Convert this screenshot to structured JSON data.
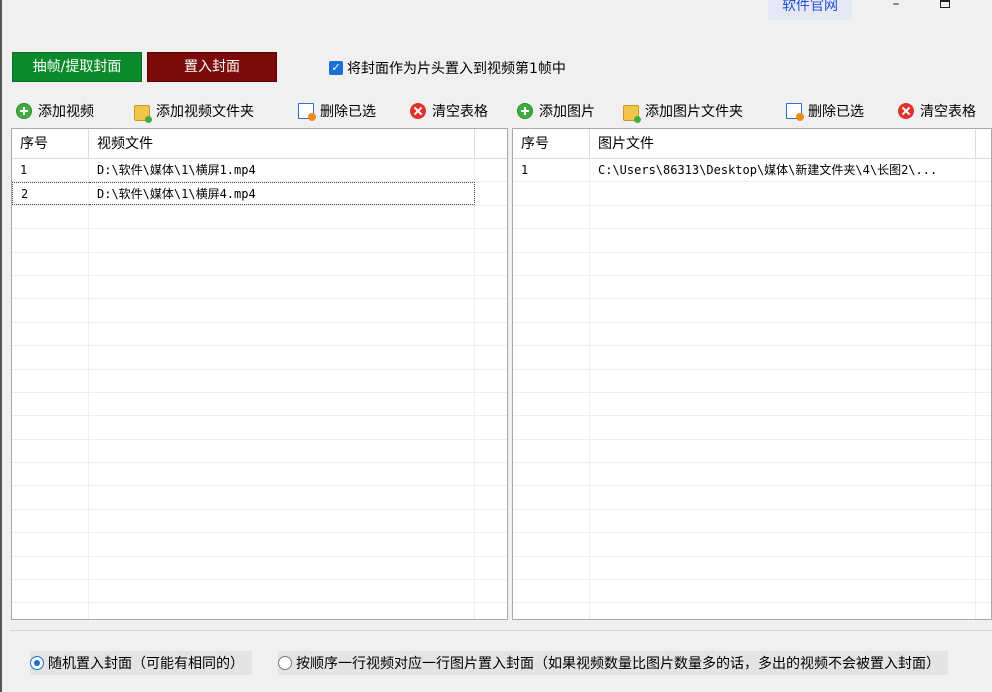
{
  "titlebar": {
    "site_link": "软件官网",
    "minimize": "–"
  },
  "actions": {
    "extract_label": "抽帧/提取封面",
    "embed_label": "置入封面",
    "checkbox_label": "将封面作为片头置入到视频第1帧中",
    "checkbox_checked": true
  },
  "left_toolbar": {
    "add": "添加视频",
    "add_folder": "添加视频文件夹",
    "delete_selected": "删除已选",
    "clear": "清空表格"
  },
  "right_toolbar": {
    "add": "添加图片",
    "add_folder": "添加图片文件夹",
    "delete_selected": "删除已选",
    "clear": "清空表格"
  },
  "video_table": {
    "headers": [
      "序号",
      "视频文件"
    ],
    "rows": [
      {
        "idx": "1",
        "file": "D:\\软件\\媒体\\1\\横屏1.mp4"
      },
      {
        "idx": "2",
        "file": "D:\\软件\\媒体\\1\\横屏4.mp4"
      }
    ]
  },
  "image_table": {
    "headers": [
      "序号",
      "图片文件"
    ],
    "rows": [
      {
        "idx": "1",
        "file": "C:\\Users\\86313\\Desktop\\媒体\\新建文件夹\\4\\长图2\\..."
      }
    ]
  },
  "options": {
    "random_label": "随机置入封面（可能有相同的）",
    "sequential_label": "按顺序一行视频对应一行图片置入封面（如果视频数量比图片数量多的话，多出的视频不会被置入封面）"
  }
}
